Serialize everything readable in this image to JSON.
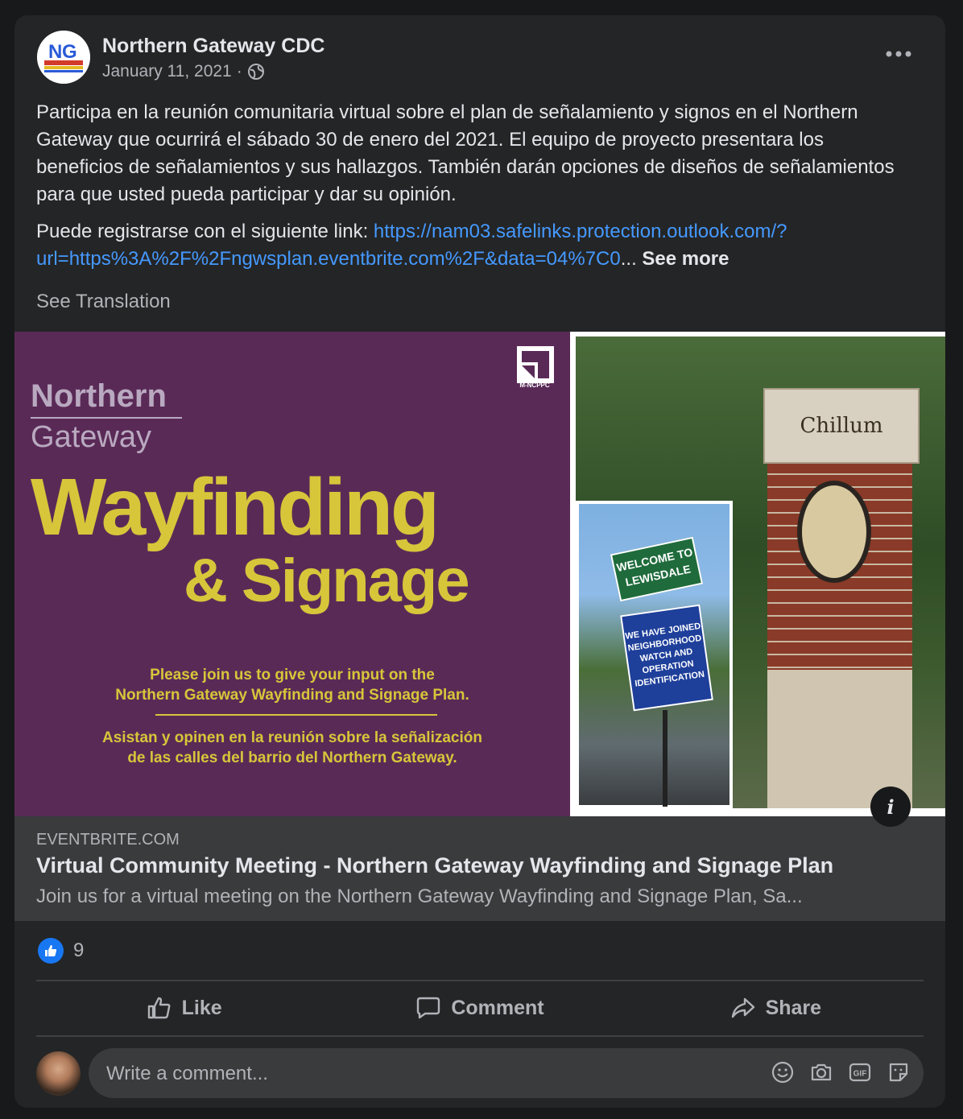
{
  "post": {
    "page_name": "Northern Gateway CDC",
    "date": "January 11, 2021",
    "separator": "·",
    "privacy_icon": "globe-icon",
    "paragraph1": "Participa en la reunión comunitaria virtual sobre el plan de señalamiento y signos en el Northern Gateway que ocurrirá el sábado 30 de enero del 2021. El equipo de proyecto presentara los beneficios de señalamientos y sus hallazgos. También darán opciones de diseños de señalamientos para que usted pueda participar y dar su opinión.",
    "paragraph2_prefix": "Puede registrarse con el siguiente link: ",
    "link_text": "https://nam03.safelinks.protection.outlook.com/?url=https%3A%2F%2Fngwsplan.eventbrite.com%2F&data=04%7C0",
    "ellipsis": "...",
    "see_more": "See more",
    "see_translation": "See Translation"
  },
  "image": {
    "logo_line1": "Northern",
    "logo_line2": "Gateway",
    "headline1": "Wayfinding",
    "headline2": "& Signage",
    "english_line1": "Please join us to give your input on the",
    "english_line2": "Northern Gateway Wayfinding and Signage Plan.",
    "spanish_line1": "Asistan y opinen en la reunión sobre la señalización",
    "spanish_line2": "de las calles del barrio del Northern Gateway.",
    "agency_label": "M-NCPPC",
    "pillar_text": "Chillum",
    "green_sign": "WELCOME TO LEWISDALE",
    "blue_sign": "WE HAVE JOINED NEIGHBORHOOD WATCH AND OPERATION IDENTIFICATION"
  },
  "preview": {
    "domain": "EVENTBRITE.COM",
    "title": "Virtual Community Meeting - Northern Gateway Wayfinding and Signage Plan",
    "description": "Join us for a virtual meeting on the Northern Gateway Wayfinding and Signage Plan, Sa..."
  },
  "reactions": {
    "count": "9"
  },
  "actions": {
    "like": "Like",
    "comment": "Comment",
    "share": "Share"
  },
  "comment": {
    "placeholder": "Write a comment..."
  },
  "colors": {
    "background": "#18191a",
    "card": "#242526",
    "link": "#4599ff",
    "purple": "#5a2a57",
    "gold": "#d7c63a",
    "like_blue": "#1877f2"
  }
}
